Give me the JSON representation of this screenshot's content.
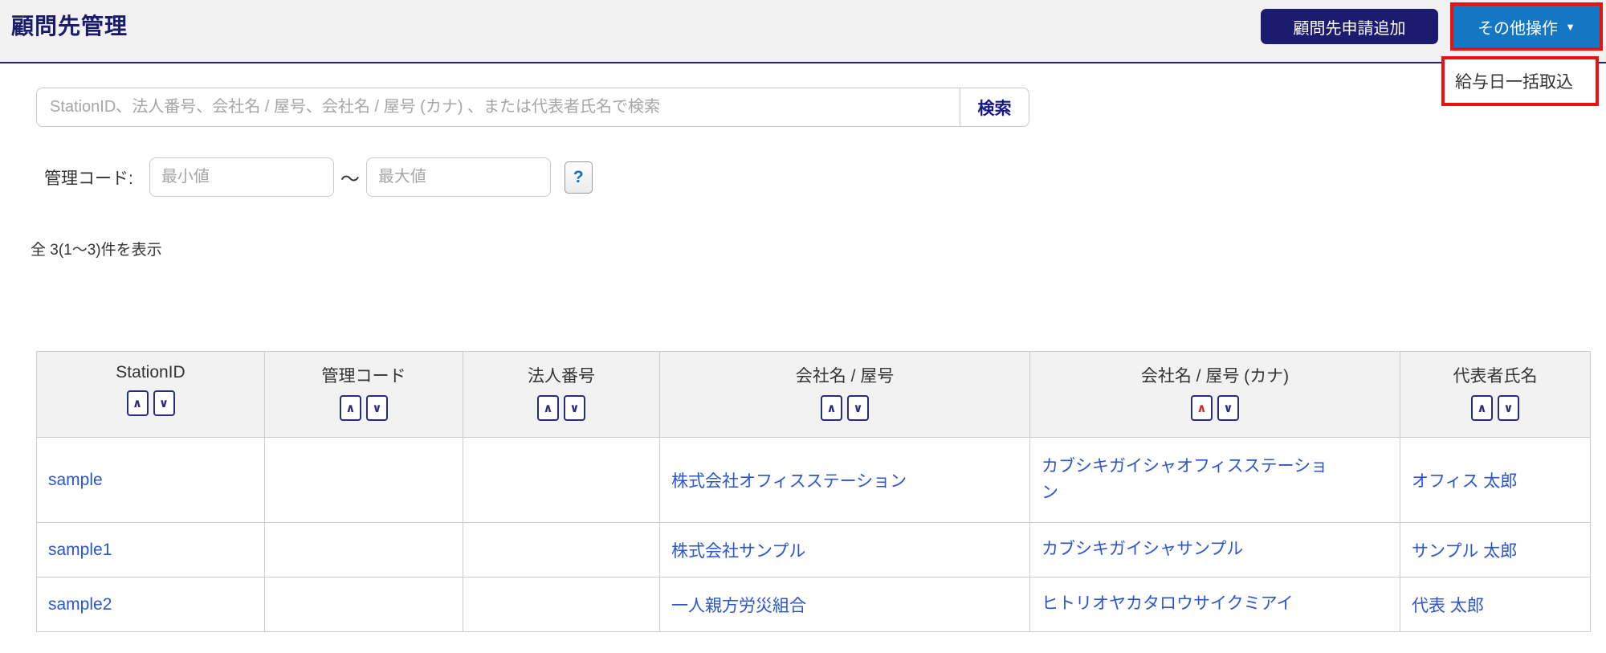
{
  "page": {
    "title": "顧問先管理"
  },
  "header": {
    "add_button_label": "顧問先申請追加",
    "more_button_label": "その他操作",
    "dropdown_items": [
      {
        "label": "給与日一括取込"
      }
    ]
  },
  "search": {
    "placeholder": "StationID、法人番号、会社名 / 屋号、会社名 / 屋号 (カナ) 、または代表者氏名で検索",
    "button_label": "検索"
  },
  "filter": {
    "label": "管理コード:",
    "min_placeholder": "最小値",
    "separator": "～",
    "max_placeholder": "最大値",
    "help_label": "?"
  },
  "results": {
    "summary": "全 3(1～3)件を表示"
  },
  "icons": {
    "sort_asc": "∧",
    "sort_desc": "∨",
    "caret_down": "▼"
  },
  "table": {
    "columns": [
      {
        "label": "StationID",
        "sort": null
      },
      {
        "label": "管理コード",
        "sort": null
      },
      {
        "label": "法人番号",
        "sort": null
      },
      {
        "label": "会社名 / 屋号",
        "sort": null
      },
      {
        "label": "会社名 / 屋号 (カナ)",
        "sort": "asc"
      },
      {
        "label": "代表者氏名",
        "sort": null
      }
    ],
    "rows": [
      {
        "station_id": "sample",
        "kanri_code": "",
        "houjin_no": "",
        "company": "株式会社オフィスステーション",
        "kana": "カブシキガイシャオフィスステーション",
        "representative": "オフィス 太郎"
      },
      {
        "station_id": "sample1",
        "kanri_code": "",
        "houjin_no": "",
        "company": "株式会社サンプル",
        "kana": "カブシキガイシャサンプル",
        "representative": "サンプル 太郎"
      },
      {
        "station_id": "sample2",
        "kanri_code": "",
        "houjin_no": "",
        "company": "一人親方労災組合",
        "kana": "ヒトリオヤカタロウサイクミアイ",
        "representative": "代表 太郎"
      }
    ]
  },
  "colors": {
    "annotation_red": "#E8120E",
    "primary_navy_button": "#1B1B70",
    "action_blue_button": "#1377C4",
    "title_navy": "#1B1B6E",
    "link_blue": "#2B55CC",
    "search_label_navy": "#15158C",
    "sort_active_red": "#D42A1E",
    "header_band_gray": "#F2F2F2"
  }
}
